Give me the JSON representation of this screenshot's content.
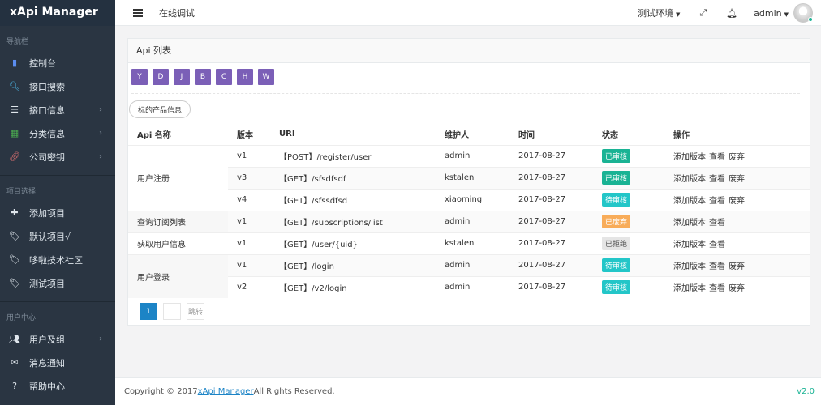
{
  "brand": "xApi Manager",
  "sidebar": {
    "sections": [
      {
        "title": "导航栏",
        "items": [
          {
            "label": "控制台",
            "icon": "bar-chart-icon",
            "color": "#5b8def",
            "chevron": false
          },
          {
            "label": "接口搜索",
            "icon": "search-icon",
            "color": "#4fc3f7",
            "chevron": false
          },
          {
            "label": "接口信息",
            "icon": "list-icon",
            "color": "#dfe6ec",
            "chevron": true
          },
          {
            "label": "分类信息",
            "icon": "grid-icon",
            "color": "#4caf50",
            "chevron": true
          },
          {
            "label": "公司密钥",
            "icon": "link-icon",
            "color": "#e57373",
            "chevron": true
          }
        ]
      },
      {
        "title": "项目选择",
        "items": [
          {
            "label": "添加项目",
            "icon": "plus-icon",
            "color": "#dfe6ec",
            "chevron": false
          },
          {
            "label": "默认项目√",
            "icon": "tag-icon",
            "color": "#dfe6ec",
            "chevron": false
          },
          {
            "label": "哆啦技术社区",
            "icon": "tag-icon",
            "color": "#dfe6ec",
            "chevron": false
          },
          {
            "label": "测试项目",
            "icon": "tag-icon",
            "color": "#dfe6ec",
            "chevron": false
          }
        ]
      },
      {
        "title": "用户中心",
        "items": [
          {
            "label": "用户及组",
            "icon": "users-icon",
            "color": "#dfe6ec",
            "chevron": true
          },
          {
            "label": "消息通知",
            "icon": "envelope-icon",
            "color": "#dfe6ec",
            "chevron": false
          },
          {
            "label": "帮助中心",
            "icon": "help-icon",
            "color": "#dfe6ec",
            "chevron": false
          }
        ]
      }
    ]
  },
  "topbar": {
    "title": "在线调试",
    "env": "测试环境",
    "user": "admin"
  },
  "panel": {
    "title": "Api 列表",
    "letters": [
      "Y",
      "D",
      "J",
      "B",
      "C",
      "H",
      "W"
    ],
    "product_pill": "标的产品信息",
    "columns": [
      "Api 名称",
      "版本",
      "URI",
      "维护人",
      "时间",
      "状态",
      "操作"
    ],
    "groups": [
      {
        "name": "用户注册",
        "rows": [
          {
            "version": "v1",
            "uri": "【POST】/register/user",
            "maintainer": "admin",
            "time": "2017-08-27",
            "status": "已审核",
            "status_color": "green",
            "ops": [
              "添加版本",
              "查看",
              "废弃"
            ]
          },
          {
            "version": "v3",
            "uri": "【GET】/sfsdfsdf",
            "maintainer": "kstalen",
            "time": "2017-08-27",
            "status": "已审核",
            "status_color": "green",
            "ops": [
              "添加版本",
              "查看",
              "废弃"
            ]
          },
          {
            "version": "v4",
            "uri": "【GET】/sfssdfsd",
            "maintainer": "xiaoming",
            "time": "2017-08-27",
            "status": "待审核",
            "status_color": "blue",
            "ops": [
              "添加版本",
              "查看",
              "废弃"
            ]
          }
        ]
      },
      {
        "name": "查询订阅列表",
        "rows": [
          {
            "version": "v1",
            "uri": "【GET】/subscriptions/list",
            "maintainer": "admin",
            "time": "2017-08-27",
            "status": "已废弃",
            "status_color": "yellow",
            "ops": [
              "添加版本",
              "查看"
            ]
          }
        ]
      },
      {
        "name": "获取用户信息",
        "rows": [
          {
            "version": "v1",
            "uri": "【GET】/user/{uid}",
            "maintainer": "kstalen",
            "time": "2017-08-27",
            "status": "已拒绝",
            "status_color": "gray",
            "ops": [
              "添加版本",
              "查看"
            ]
          }
        ]
      },
      {
        "name": "用户登录",
        "rows": [
          {
            "version": "v1",
            "uri": "【GET】/login",
            "maintainer": "admin",
            "time": "2017-08-27",
            "status": "待审核",
            "status_color": "blue",
            "ops": [
              "添加版本",
              "查看",
              "废弃"
            ]
          },
          {
            "version": "v2",
            "uri": "【GET】/v2/login",
            "maintainer": "admin",
            "time": "2017-08-27",
            "status": "待审核",
            "status_color": "blue",
            "ops": [
              "添加版本",
              "查看",
              "废弃"
            ]
          }
        ]
      }
    ],
    "pager": {
      "current": "1",
      "jump": "跳转"
    }
  },
  "footer": {
    "prefix": "Copyright © 2017 ",
    "link": "xApi Manager ",
    "suffix": "All Rights Reserved.",
    "version": "v2.0"
  }
}
